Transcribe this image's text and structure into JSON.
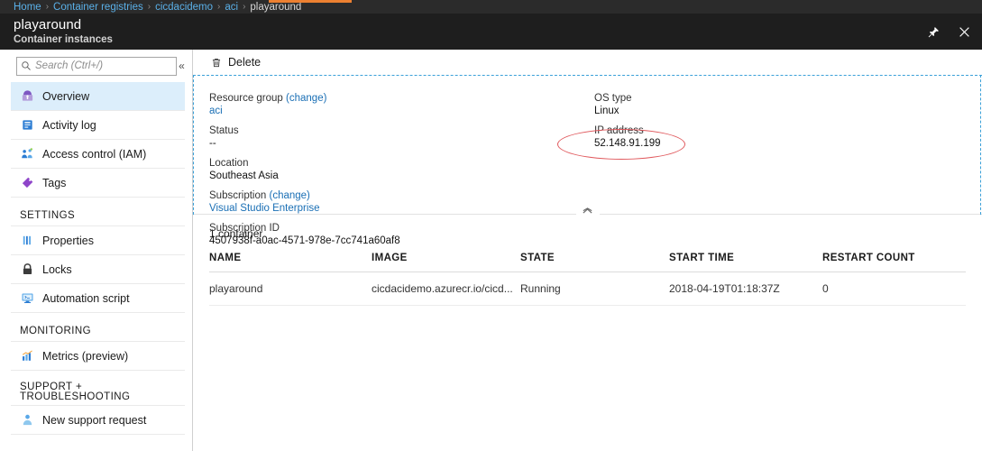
{
  "breadcrumb": {
    "items": [
      {
        "label": "Home",
        "is_current": false
      },
      {
        "label": "Container registries",
        "is_current": false
      },
      {
        "label": "cicdacidemo",
        "is_current": false
      },
      {
        "label": "aci",
        "is_current": false
      },
      {
        "label": "playaround",
        "is_current": true
      }
    ],
    "separator": "›",
    "accent_color": "#ec8031"
  },
  "header": {
    "title": "playaround",
    "subtitle": "Container instances",
    "pin_icon": "pin-icon",
    "close_icon": "close-icon",
    "background": "#1e1e1e"
  },
  "sidebar": {
    "search": {
      "placeholder": "Search (Ctrl+/)",
      "value": "",
      "icon": "search-icon"
    },
    "collapse_icon": "chevron-double-left-icon",
    "items": [
      {
        "label": "Overview",
        "icon": "overview-icon",
        "selected": true,
        "type": "item"
      },
      {
        "label": "Activity log",
        "icon": "activity-log-icon",
        "selected": false,
        "type": "item"
      },
      {
        "label": "Access control (IAM)",
        "icon": "access-control-icon",
        "selected": false,
        "type": "item"
      },
      {
        "label": "Tags",
        "icon": "tag-icon",
        "selected": false,
        "type": "item"
      },
      {
        "label": "SETTINGS",
        "type": "group"
      },
      {
        "label": "Properties",
        "icon": "properties-icon",
        "selected": false,
        "type": "item"
      },
      {
        "label": "Locks",
        "icon": "lock-icon",
        "selected": false,
        "type": "item"
      },
      {
        "label": "Automation script",
        "icon": "automation-script-icon",
        "selected": false,
        "type": "item"
      },
      {
        "label": "MONITORING",
        "type": "group"
      },
      {
        "label": "Metrics (preview)",
        "icon": "metrics-icon",
        "selected": false,
        "type": "item"
      },
      {
        "label": "SUPPORT + TROUBLESHOOTING",
        "type": "group",
        "two_line": true,
        "line1": "SUPPORT +",
        "line2": "TROUBLESHOOTING"
      },
      {
        "label": "New support request",
        "icon": "support-request-icon",
        "selected": false,
        "type": "item"
      }
    ]
  },
  "command_bar": {
    "delete_label": "Delete",
    "delete_icon": "trash-icon"
  },
  "essentials": {
    "collapse_icon": "chevron-up-icon",
    "left_column": [
      {
        "label": "Resource group",
        "label_link": "(change)",
        "value": "aci",
        "value_is_link": true
      },
      {
        "label": "Status",
        "value": "--",
        "value_is_link": false
      },
      {
        "label": "Location",
        "value": "Southeast Asia",
        "value_is_link": false
      },
      {
        "label": "Subscription",
        "label_link": "(change)",
        "value": "Visual Studio Enterprise",
        "value_is_link": true
      },
      {
        "label": "Subscription ID",
        "value": "4507938f-a0ac-4571-978e-7cc741a60af8",
        "value_is_link": false
      }
    ],
    "right_column": [
      {
        "label": "OS type",
        "value": "Linux",
        "value_is_link": false
      },
      {
        "label": "IP address",
        "value": "52.148.91.199",
        "value_is_link": false,
        "annotated": true
      }
    ],
    "annotation": {
      "shape": "ellipse",
      "color": "#e0585c",
      "target": "IP address value"
    }
  },
  "containers": {
    "count_label": "1 container",
    "columns": [
      "NAME",
      "IMAGE",
      "STATE",
      "START TIME",
      "RESTART COUNT"
    ],
    "rows": [
      {
        "name": "playaround",
        "image": "cicdacidemo.azurecr.io/cicd...",
        "state": "Running",
        "start_time": "2018-04-19T01:18:37Z",
        "restart_count": "0"
      }
    ]
  }
}
